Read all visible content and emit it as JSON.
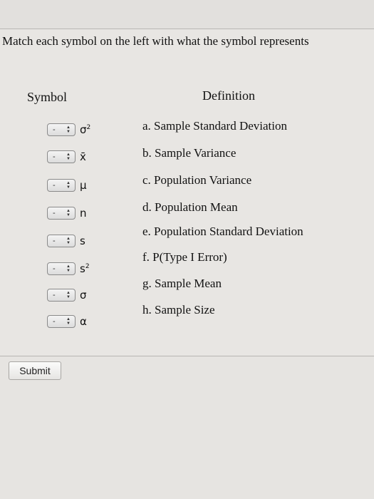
{
  "question": "Match each symbol on the left with what the symbol represents",
  "headers": {
    "symbol": "Symbol",
    "definition": "Definition"
  },
  "rows": [
    {
      "select_value": "-",
      "symbol": "σ",
      "sup": "2"
    },
    {
      "select_value": "-",
      "symbol": "x̄",
      "sup": ""
    },
    {
      "select_value": "-",
      "symbol": "μ",
      "sup": ""
    },
    {
      "select_value": "-",
      "symbol": "n",
      "sup": ""
    },
    {
      "select_value": "-",
      "symbol": "s",
      "sup": ""
    },
    {
      "select_value": "-",
      "symbol": "s",
      "sup": "2"
    },
    {
      "select_value": "-",
      "symbol": "σ",
      "sup": ""
    },
    {
      "select_value": "-",
      "symbol": "α",
      "sup": ""
    }
  ],
  "definitions": [
    "a. Sample Standard Deviation",
    "b. Sample Variance",
    "c. Population Variance",
    "d. Population Mean",
    "e. Population Standard Deviation",
    "f. P(Type I Error)",
    "g. Sample Mean",
    "h. Sample Size"
  ],
  "submit_label": "Submit"
}
